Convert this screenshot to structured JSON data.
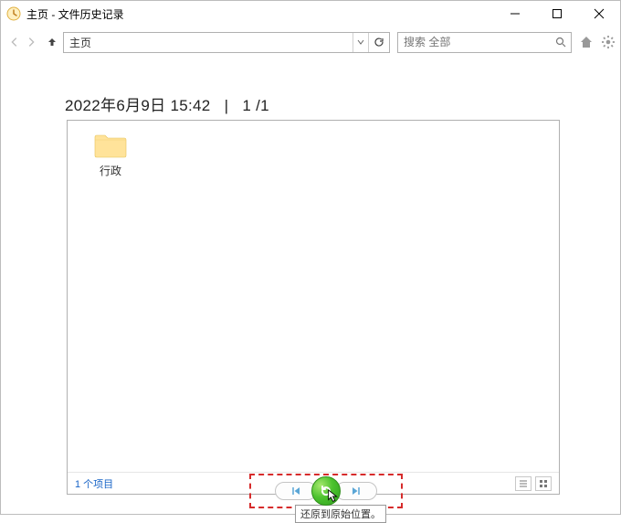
{
  "window": {
    "title": "主页 - 文件历史记录"
  },
  "address": {
    "text": "主页"
  },
  "search": {
    "placeholder": "搜索 全部"
  },
  "header": {
    "timestamp": "2022年6月9日 15:42",
    "page_indicator": "1 /1"
  },
  "folders": [
    {
      "name": "行政"
    }
  ],
  "status": {
    "item_count": "1 个项目"
  },
  "controls": {
    "tooltip": "还原到原始位置。"
  }
}
